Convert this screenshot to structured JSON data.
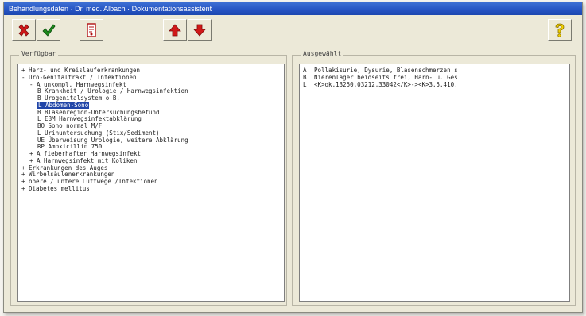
{
  "window": {
    "title": "Behandlungsdaten · Dr. med. Albach · Dokumentationsassistent"
  },
  "toolbar": {
    "buttons": [
      {
        "name": "delete-button",
        "icon": "delete-x-icon"
      },
      {
        "name": "confirm-button",
        "icon": "checkmark-icon"
      },
      {
        "name": "document-button",
        "icon": "document-icon"
      },
      {
        "name": "move-up-button",
        "icon": "arrow-up-icon"
      },
      {
        "name": "move-down-button",
        "icon": "arrow-down-icon"
      },
      {
        "name": "help-button",
        "icon": "question-mark-icon"
      }
    ]
  },
  "available": {
    "label": "Verfügbar",
    "items": [
      {
        "level": 0,
        "text": "+ Herz- und  Kreislauferkrankungen"
      },
      {
        "level": 0,
        "text": "- Uro-Genitaltrakt / Infektionen"
      },
      {
        "level": 1,
        "text": "- A unkompl. Harnwegsinfekt"
      },
      {
        "level": 2,
        "text": "B Krankheit / Urologie / Harnwegsinfektion"
      },
      {
        "level": 2,
        "text": "B Urogenitalsystem o.B."
      },
      {
        "level": 2,
        "text": "L Abdomen-Sono",
        "selected": true
      },
      {
        "level": 2,
        "text": "B Blasenregion-Untersuchungsbefund"
      },
      {
        "level": 2,
        "text": "L EBM Harnwegsinfektabklärung"
      },
      {
        "level": 2,
        "text": "BO Sono normal M/F"
      },
      {
        "level": 2,
        "text": "L Urinuntersuchung (Stix/Sediment)"
      },
      {
        "level": 2,
        "text": "UE Überweisung Urologie, weitere Abklärung"
      },
      {
        "level": 2,
        "text": "RP Amoxicillin 750"
      },
      {
        "level": 1,
        "text": "+ A fieberhafter Harnwegsinfekt"
      },
      {
        "level": 1,
        "text": "+ A Harnwegsinfekt mit Koliken"
      },
      {
        "level": 0,
        "text": "+ Erkrankungen des Auges"
      },
      {
        "level": 0,
        "text": "+ Wirbelsäulenerkrankungen"
      },
      {
        "level": 0,
        "text": "+ obere / untere Luftwege /Infektionen"
      },
      {
        "level": 0,
        "text": "+ Diabetes mellitus"
      }
    ]
  },
  "selected": {
    "label": "Ausgewählt",
    "items": [
      {
        "code": "A",
        "text": "Pollakisurie, Dysurie, Blasenschmerzen s"
      },
      {
        "code": "B",
        "text": "Nierenlager beidseits frei, Harn- u. Ges"
      },
      {
        "code": "L",
        "text": "<K>ok.13250,03212,33042</K>-><K>3.5.410."
      }
    ]
  },
  "colors": {
    "title_bar": "#2553c2",
    "selection": "#2146a8",
    "accent_red": "#d01818",
    "accent_green": "#1d8a1d",
    "help_yellow": "#f0d000"
  }
}
